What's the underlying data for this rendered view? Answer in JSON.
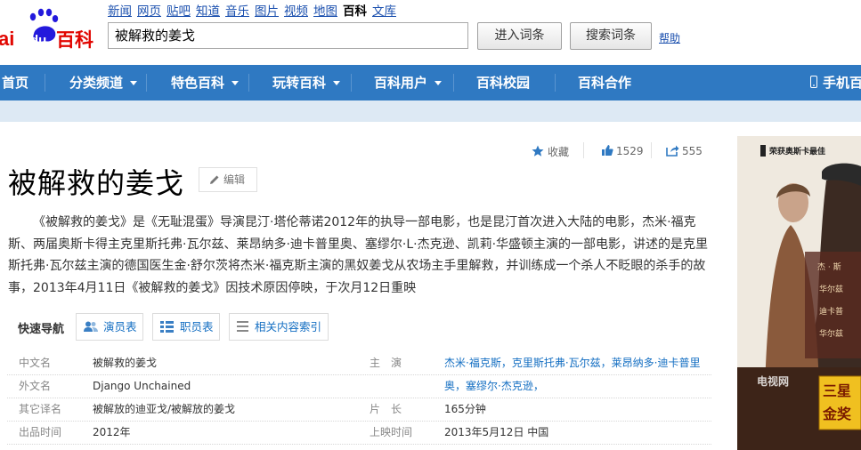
{
  "header": {
    "logo_text": "Bai du 百科",
    "links": [
      "新闻",
      "网页",
      "贴吧",
      "知道",
      "音乐",
      "图片",
      "视频",
      "地图",
      "百科",
      "文库"
    ],
    "active_link": "百科",
    "search_value": "被解救的姜戈",
    "btn_enter": "进入词条",
    "btn_search": "搜索词条",
    "help": "帮助"
  },
  "nav": {
    "items": [
      "首页",
      "分类频道",
      "特色百科",
      "玩转百科",
      "百科用户",
      "百科校园",
      "百科合作"
    ],
    "mobile": "手机百"
  },
  "actions": {
    "collect": "收藏",
    "likes": "1529",
    "shares": "555"
  },
  "article": {
    "title": "被解救的姜戈",
    "edit": "编辑",
    "intro": "《被解救的姜戈》是《无耻混蛋》导演昆汀·塔伦蒂诺2012年的执导一部电影，也是昆汀首次进入大陆的电影，杰米·福克斯、两届奥斯卡得主克里斯托弗·瓦尔兹、莱昂纳多·迪卡普里奥、塞缪尔·L·杰克逊、凯莉·华盛顿主演的一部电影，讲述的是克里斯托弗·瓦尔兹主演的德国医生金·舒尔茨将杰米·福克斯主演的黑奴姜戈从农场主手里解救，并训练成一个杀人不眨眼的杀手的故事，2013年4月11日《被解救的姜戈》因技术原因停映，于次月12日重映"
  },
  "quicknav": {
    "label": "快速导航",
    "buttons": [
      "演员表",
      "职员表",
      "相关内容索引"
    ]
  },
  "infobox": {
    "rows": [
      {
        "l1": "中文名",
        "v1": "被解救的姜戈",
        "l2": "主　演",
        "v2": "杰米·福克斯，克里斯托弗·瓦尔兹，莱昂纳多·迪卡普里"
      },
      {
        "l1": "外文名",
        "v1": "Django Unchained",
        "l2": "",
        "v2": "奥，塞缪尔·杰克逊，"
      },
      {
        "l1": "其它译名",
        "v1": "被解放的迪亚戈/被解放的姜戈",
        "l2": "片　长",
        "v2": "165分钟"
      },
      {
        "l1": "出品时间",
        "v1": "2012年",
        "l2": "上映时间",
        "v2": "2013年5月12日 中国"
      }
    ]
  },
  "poster": {
    "top_text": "荣获奥斯卡最佳",
    "badge": "三星\n金奖",
    "watermark": "电视网"
  },
  "colors": {
    "nav": "#2f79c2",
    "link": "#136ec2",
    "logo_red": "#e10601",
    "logo_blue": "#2319dc"
  }
}
